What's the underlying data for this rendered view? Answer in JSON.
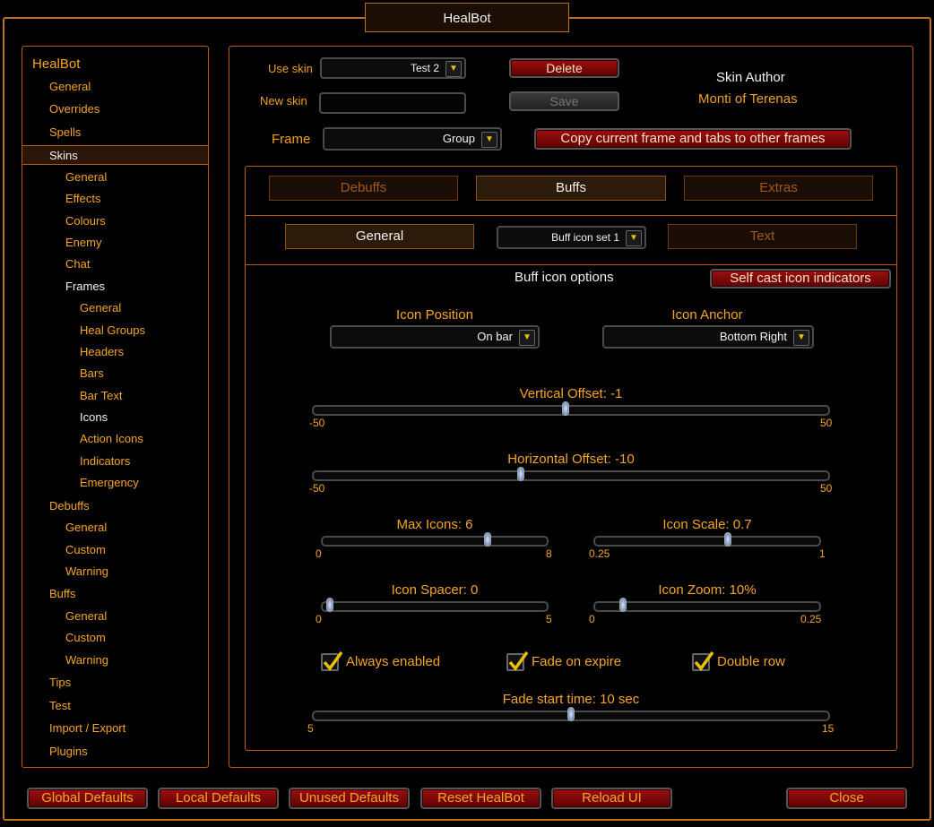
{
  "window": {
    "title": "HealBot"
  },
  "nav": {
    "items": [
      {
        "label": "HealBot"
      },
      {
        "label": "General"
      },
      {
        "label": "Overrides"
      },
      {
        "label": "Spells"
      },
      {
        "label": "Skins"
      },
      {
        "label": "General"
      },
      {
        "label": "Effects"
      },
      {
        "label": "Colours"
      },
      {
        "label": "Enemy"
      },
      {
        "label": "Chat"
      },
      {
        "label": "Frames"
      },
      {
        "label": "General"
      },
      {
        "label": "Heal Groups"
      },
      {
        "label": "Headers"
      },
      {
        "label": "Bars"
      },
      {
        "label": "Bar Text"
      },
      {
        "label": "Icons"
      },
      {
        "label": "Action Icons"
      },
      {
        "label": "Indicators"
      },
      {
        "label": "Emergency"
      },
      {
        "label": "Debuffs"
      },
      {
        "label": "General"
      },
      {
        "label": "Custom"
      },
      {
        "label": "Warning"
      },
      {
        "label": "Buffs"
      },
      {
        "label": "General"
      },
      {
        "label": "Custom"
      },
      {
        "label": "Warning"
      },
      {
        "label": "Tips"
      },
      {
        "label": "Test"
      },
      {
        "label": "Import / Export"
      },
      {
        "label": "Plugins"
      }
    ]
  },
  "skin": {
    "use_skin_label": "Use skin",
    "use_skin_value": "Test 2",
    "new_skin_label": "New skin",
    "new_skin_value": "",
    "delete_label": "Delete",
    "save_label": "Save",
    "author_heading": "Skin Author",
    "author_name": "Monti of Terenas",
    "frame_label": "Frame",
    "frame_value": "Group",
    "copy_label": "Copy current frame and tabs to other frames"
  },
  "tabs": {
    "debuffs": "Debuffs",
    "buffs": "Buffs",
    "extras": "Extras"
  },
  "subtabs": {
    "general": "General",
    "icon_set": "Buff icon set 1",
    "text": "Text"
  },
  "options": {
    "heading": "Buff icon options",
    "self_cast_label": "Self cast icon indicators",
    "icon_position_label": "Icon Position",
    "icon_position_value": "On bar",
    "icon_anchor_label": "Icon Anchor",
    "icon_anchor_value": "Bottom Right",
    "sliders": {
      "vertical": {
        "label": "Vertical Offset: -1",
        "min": "-50",
        "max": "50",
        "value": -1,
        "lo": -50,
        "hi": 50
      },
      "horizontal": {
        "label": "Horizontal Offset: -10",
        "min": "-50",
        "max": "50",
        "value": -10,
        "lo": -50,
        "hi": 50
      },
      "max_icons": {
        "label": "Max Icons: 6",
        "min": "0",
        "max": "8",
        "value": 6,
        "lo": 0,
        "hi": 8
      },
      "icon_scale": {
        "label": "Icon Scale: 0.7",
        "min": "0.25",
        "max": "1",
        "value": 0.7,
        "lo": 0.25,
        "hi": 1
      },
      "icon_spacer": {
        "label": "Icon Spacer: 0",
        "min": "0",
        "max": "5",
        "value": 0,
        "lo": 0,
        "hi": 5
      },
      "icon_zoom": {
        "label": "Icon Zoom: 10%",
        "min": "0",
        "max": "0.25",
        "value": 0.025,
        "lo": 0,
        "hi": 0.25
      },
      "fade_start": {
        "label": "Fade start time: 10 sec",
        "min": "5",
        "max": "15",
        "value": 10,
        "lo": 5,
        "hi": 15
      }
    },
    "checkboxes": {
      "always_enabled": {
        "label": "Always enabled",
        "checked": true
      },
      "fade_on_expire": {
        "label": "Fade on expire",
        "checked": true
      },
      "double_row": {
        "label": "Double row",
        "checked": true
      }
    }
  },
  "footer": {
    "global_defaults": "Global Defaults",
    "local_defaults": "Local Defaults",
    "unused_defaults": "Unused Defaults",
    "reset_healbot": "Reset HealBot",
    "reload_ui": "Reload UI",
    "close": "Close"
  },
  "colors": {
    "accent": "#f5a526",
    "border": "#b85c14",
    "button_red": "#a10e0e",
    "text_white": "#f2f2f2"
  }
}
